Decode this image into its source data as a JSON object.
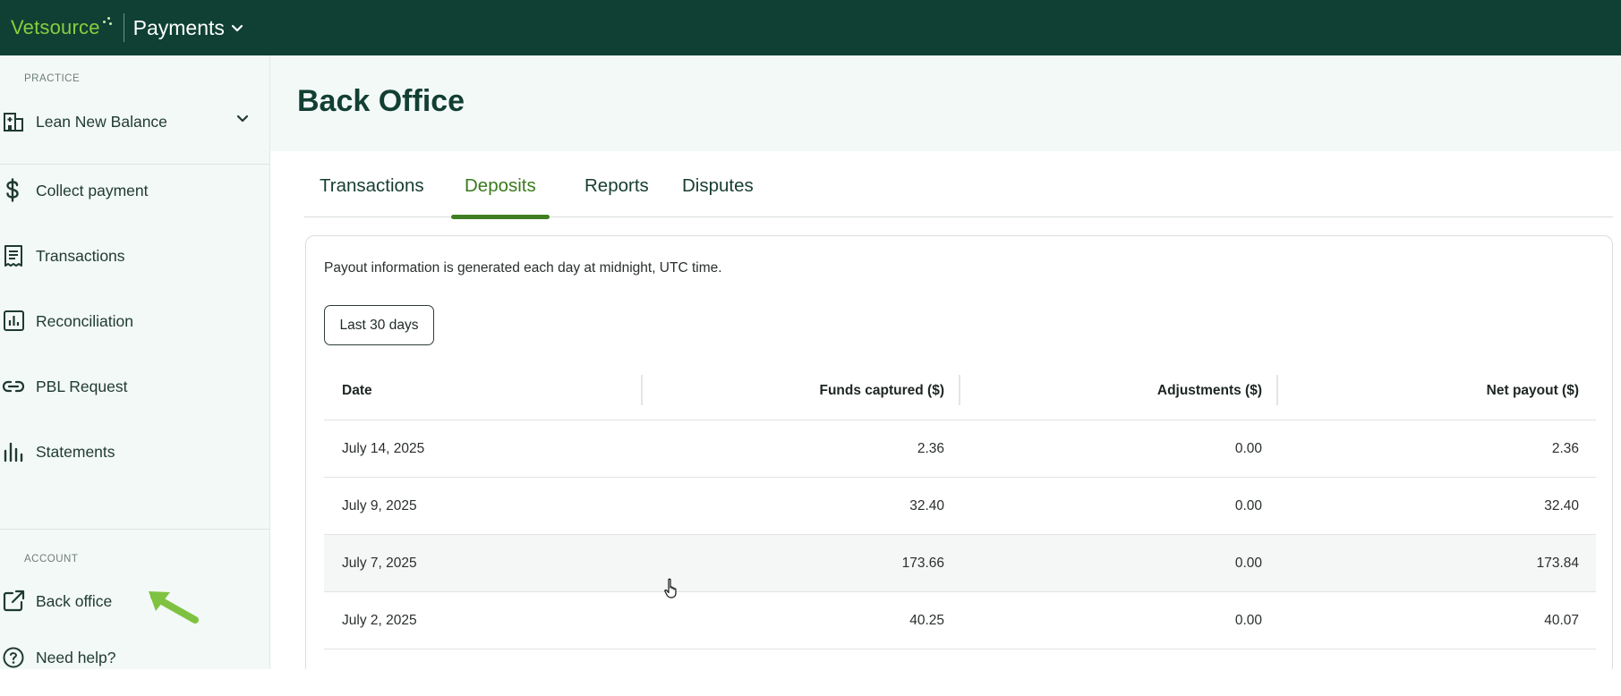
{
  "topbar": {
    "logo_text": "Vetsource",
    "app_name": "Payments"
  },
  "sidebar": {
    "practice_label": "PRACTICE",
    "practice_name": "Lean New Balance",
    "items": [
      {
        "label": "Collect payment",
        "icon": "dollar-icon"
      },
      {
        "label": "Transactions",
        "icon": "receipt-icon"
      },
      {
        "label": "Reconciliation",
        "icon": "report-chart-icon"
      },
      {
        "label": "PBL Request",
        "icon": "link-icon"
      },
      {
        "label": "Statements",
        "icon": "bar-chart-icon"
      }
    ],
    "account_label": "ACCOUNT",
    "account_items": [
      {
        "label": "Back office",
        "icon": "external-link-icon"
      },
      {
        "label": "Need help?",
        "icon": "help-circle-icon"
      }
    ]
  },
  "main": {
    "title": "Back Office",
    "tabs": [
      {
        "label": "Transactions",
        "active": false
      },
      {
        "label": "Deposits",
        "active": true
      },
      {
        "label": "Reports",
        "active": false
      },
      {
        "label": "Disputes",
        "active": false
      }
    ],
    "info_text": "Payout information is generated each day at midnight, UTC time.",
    "date_range_label": "Last 30 days",
    "table": {
      "headers": [
        "Date",
        "Funds captured ($)",
        "Adjustments ($)",
        "Net payout ($)"
      ],
      "rows": [
        {
          "date": "July 14, 2025",
          "funds": "2.36",
          "adjustments": "0.00",
          "net": "2.36"
        },
        {
          "date": "July 9, 2025",
          "funds": "32.40",
          "adjustments": "0.00",
          "net": "32.40"
        },
        {
          "date": "July 7, 2025",
          "funds": "173.66",
          "adjustments": "0.00",
          "net": "173.84"
        },
        {
          "date": "July 2, 2025",
          "funds": "40.25",
          "adjustments": "0.00",
          "net": "40.07"
        }
      ]
    }
  },
  "colors": {
    "topbar_bg": "#0f4033",
    "logo_green": "#8ccc3f",
    "active_tab": "#3a7a1d",
    "sidebar_bg": "#f3f9f7",
    "annotation_arrow": "#7fc241"
  }
}
